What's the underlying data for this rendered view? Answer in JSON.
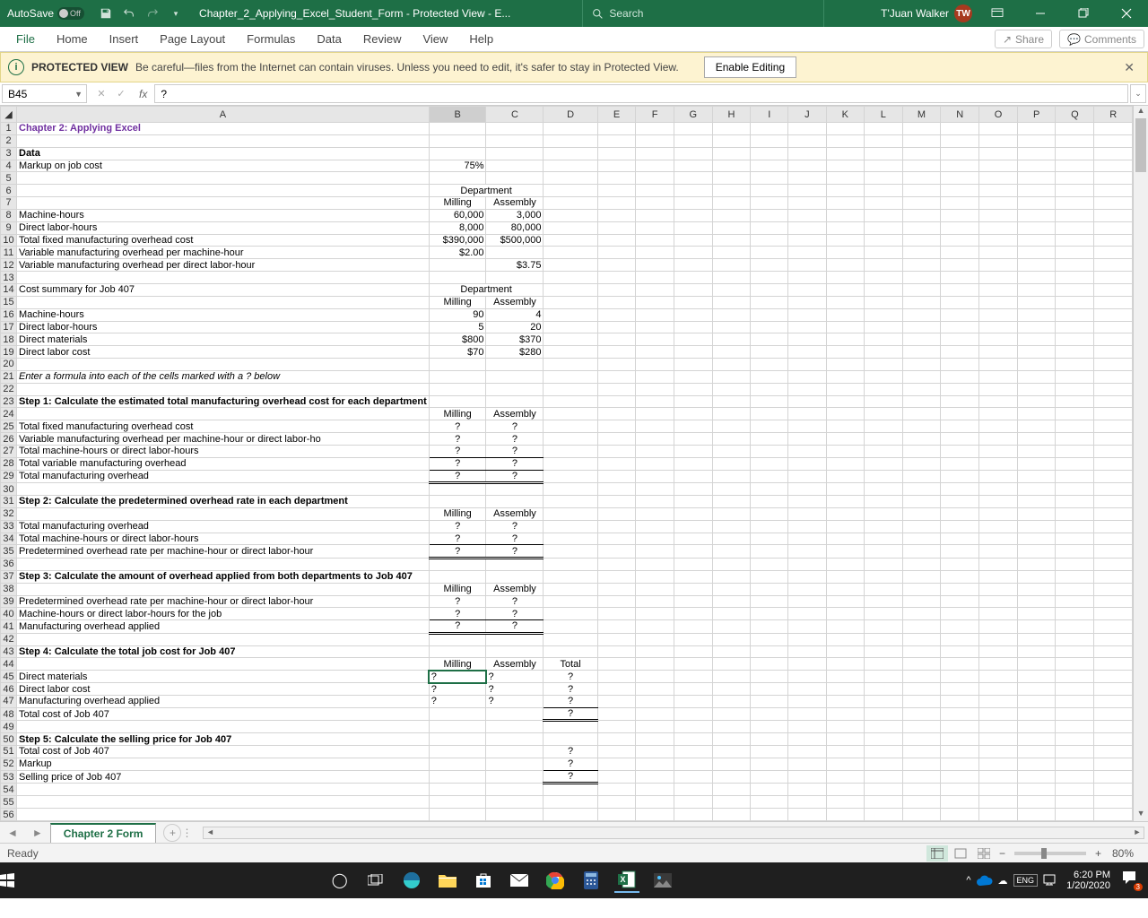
{
  "titlebar": {
    "autosave_label": "AutoSave",
    "autosave_state": "Off",
    "doc_title": "Chapter_2_Applying_Excel_Student_Form  -  Protected View  -  E...",
    "search_placeholder": "Search",
    "user_name": "T'Juan Walker",
    "user_initials": "TW"
  },
  "ribbon": {
    "tabs": [
      "File",
      "Home",
      "Insert",
      "Page Layout",
      "Formulas",
      "Data",
      "Review",
      "View",
      "Help"
    ],
    "share": "Share",
    "comments": "Comments"
  },
  "protected": {
    "title": "PROTECTED VIEW",
    "msg": "Be careful—files from the Internet can contain viruses. Unless you need to edit, it's safer to stay in Protected View.",
    "enable": "Enable Editing"
  },
  "formula": {
    "namebox": "B45",
    "value": "?"
  },
  "columns": [
    "A",
    "B",
    "C",
    "D",
    "E",
    "F",
    "G",
    "H",
    "I",
    "J",
    "K",
    "L",
    "M",
    "N",
    "O",
    "P",
    "Q",
    "R"
  ],
  "rows": [
    {
      "n": 1,
      "A": "Chapter 2: Applying Excel",
      "cls": {
        "A": "purple left"
      }
    },
    {
      "n": 2
    },
    {
      "n": 3,
      "A": "Data",
      "cls": {
        "A": "bold left"
      }
    },
    {
      "n": 4,
      "A": "Markup on job cost",
      "B": "75%",
      "cls": {
        "A": "left"
      }
    },
    {
      "n": 5
    },
    {
      "n": 6,
      "B": "Department",
      "cls": {
        "B": "center",
        "merge": "BC"
      }
    },
    {
      "n": 7,
      "B": "Milling",
      "C": "Assembly",
      "cls": {
        "B": "center",
        "C": "center"
      }
    },
    {
      "n": 8,
      "A": "Machine-hours",
      "B": "60,000",
      "C": "3,000",
      "cls": {
        "A": "left"
      }
    },
    {
      "n": 9,
      "A": "Direct labor-hours",
      "B": "8,000",
      "C": "80,000",
      "cls": {
        "A": "left"
      }
    },
    {
      "n": 10,
      "A": "Total fixed manufacturing overhead cost",
      "B": "$390,000",
      "C": "$500,000",
      "cls": {
        "A": "left"
      }
    },
    {
      "n": 11,
      "A": "Variable manufacturing overhead per machine-hour",
      "B": "$2.00",
      "cls": {
        "A": "left"
      }
    },
    {
      "n": 12,
      "A": "Variable manufacturing overhead per direct labor-hour",
      "C": "$3.75",
      "cls": {
        "A": "left"
      }
    },
    {
      "n": 13
    },
    {
      "n": 14,
      "A": "Cost summary for Job 407",
      "B": "Department",
      "cls": {
        "A": "left",
        "B": "center",
        "merge": "BC"
      }
    },
    {
      "n": 15,
      "B": "Milling",
      "C": "Assembly",
      "cls": {
        "B": "center",
        "C": "center"
      }
    },
    {
      "n": 16,
      "A": "Machine-hours",
      "B": "90",
      "C": "4",
      "cls": {
        "A": "left"
      }
    },
    {
      "n": 17,
      "A": "Direct labor-hours",
      "B": "5",
      "C": "20",
      "cls": {
        "A": "left"
      }
    },
    {
      "n": 18,
      "A": "Direct materials",
      "B": "$800",
      "C": "$370",
      "cls": {
        "A": "left"
      }
    },
    {
      "n": 19,
      "A": "Direct labor cost",
      "B": "$70",
      "C": "$280",
      "cls": {
        "A": "left"
      }
    },
    {
      "n": 20
    },
    {
      "n": 21,
      "A": "Enter a formula into each of the cells marked with a ? below",
      "cls": {
        "A": "italic left"
      }
    },
    {
      "n": 22
    },
    {
      "n": 23,
      "A": "Step 1: Calculate the estimated total manufacturing overhead cost for each department",
      "cls": {
        "A": "bold left"
      }
    },
    {
      "n": 24,
      "B": "Milling",
      "C": "Assembly",
      "cls": {
        "B": "center",
        "C": "center"
      }
    },
    {
      "n": 25,
      "A": "Total fixed manufacturing overhead cost",
      "B": "?",
      "C": "?",
      "cls": {
        "A": "left",
        "B": "center",
        "C": "center"
      }
    },
    {
      "n": 26,
      "A": "Variable manufacturing overhead per machine-hour or direct labor-ho",
      "B": "?",
      "C": "?",
      "cls": {
        "A": "left",
        "B": "center",
        "C": "center"
      }
    },
    {
      "n": 27,
      "A": "Total machine-hours or direct labor-hours",
      "B": "?",
      "C": "?",
      "cls": {
        "A": "left",
        "B": "center underline-bot",
        "C": "center underline-bot"
      }
    },
    {
      "n": 28,
      "A": "Total variable manufacturing overhead",
      "B": "?",
      "C": "?",
      "cls": {
        "A": "left",
        "B": "center underline-bot",
        "C": "center underline-bot"
      }
    },
    {
      "n": 29,
      "A": "Total manufacturing overhead",
      "B": "?",
      "C": "?",
      "cls": {
        "A": "left",
        "B": "center dbl-bot",
        "C": "center dbl-bot"
      }
    },
    {
      "n": 30
    },
    {
      "n": 31,
      "A": "Step 2: Calculate the predetermined overhead rate in each department",
      "cls": {
        "A": "bold left"
      }
    },
    {
      "n": 32,
      "B": "Milling",
      "C": "Assembly",
      "cls": {
        "B": "center",
        "C": "center"
      }
    },
    {
      "n": 33,
      "A": "Total manufacturing overhead",
      "B": "?",
      "C": "?",
      "cls": {
        "A": "left",
        "B": "center",
        "C": "center"
      }
    },
    {
      "n": 34,
      "A": "Total machine-hours or direct labor-hours",
      "B": "?",
      "C": "?",
      "cls": {
        "A": "left",
        "B": "center underline-bot",
        "C": "center underline-bot"
      }
    },
    {
      "n": 35,
      "A": "Predetermined overhead rate per machine-hour or direct labor-hour",
      "B": "?",
      "C": "?",
      "cls": {
        "A": "left",
        "B": "center dbl-bot",
        "C": "center dbl-bot"
      }
    },
    {
      "n": 36
    },
    {
      "n": 37,
      "A": "Step 3: Calculate the amount of overhead applied from both departments to Job 407",
      "cls": {
        "A": "bold left"
      }
    },
    {
      "n": 38,
      "B": "Milling",
      "C": "Assembly",
      "cls": {
        "B": "center",
        "C": "center"
      }
    },
    {
      "n": 39,
      "A": "Predetermined overhead rate per machine-hour or direct labor-hour",
      "B": "?",
      "C": "?",
      "cls": {
        "A": "left",
        "B": "center",
        "C": "center"
      }
    },
    {
      "n": 40,
      "A": "Machine-hours or direct labor-hours for the job",
      "B": "?",
      "C": "?",
      "cls": {
        "A": "left",
        "B": "center underline-bot",
        "C": "center underline-bot"
      }
    },
    {
      "n": 41,
      "A": "Manufacturing overhead applied",
      "B": "?",
      "C": "?",
      "cls": {
        "A": "left",
        "B": "center dbl-bot",
        "C": "center dbl-bot"
      }
    },
    {
      "n": 42
    },
    {
      "n": 43,
      "A": "Step 4: Calculate the total job cost for Job 407",
      "cls": {
        "A": "bold left"
      }
    },
    {
      "n": 44,
      "B": "Milling",
      "C": "Assembly",
      "D": "Total",
      "cls": {
        "B": "center",
        "C": "center",
        "D": "center"
      }
    },
    {
      "n": 45,
      "A": "Direct materials",
      "B": "?",
      "C": "?",
      "D": "?",
      "cls": {
        "A": "left",
        "B": "left sel-cell",
        "C": "left",
        "D": "center"
      }
    },
    {
      "n": 46,
      "A": "Direct labor cost",
      "B": "?",
      "C": "?",
      "D": "?",
      "cls": {
        "A": "left",
        "B": "left",
        "C": "left",
        "D": "center"
      }
    },
    {
      "n": 47,
      "A": "Manufacturing overhead applied",
      "B": "?",
      "C": "?",
      "D": "?",
      "cls": {
        "A": "left",
        "B": "left",
        "C": "left",
        "D": "center underline-bot"
      }
    },
    {
      "n": 48,
      "A": "Total cost of Job 407",
      "D": "?",
      "cls": {
        "A": "left",
        "D": "center dbl-bot"
      }
    },
    {
      "n": 49
    },
    {
      "n": 50,
      "A": "Step 5: Calculate the selling price for Job 407",
      "cls": {
        "A": "bold left"
      }
    },
    {
      "n": 51,
      "A": "Total cost of Job 407",
      "D": "?",
      "cls": {
        "A": "left",
        "D": "center"
      }
    },
    {
      "n": 52,
      "A": "Markup",
      "D": "?",
      "cls": {
        "A": "left",
        "D": "center underline-bot"
      }
    },
    {
      "n": 53,
      "A": "Selling price of Job 407",
      "D": "?",
      "cls": {
        "A": "left",
        "D": "center dbl-bot"
      }
    },
    {
      "n": 54
    },
    {
      "n": 55
    },
    {
      "n": 56
    }
  ],
  "sheet": {
    "name": "Chapter 2 Form"
  },
  "status": {
    "ready": "Ready",
    "zoom": "80%"
  },
  "taskbar": {
    "time": "6:20 PM",
    "date": "1/20/2020",
    "notif_count": "3"
  }
}
